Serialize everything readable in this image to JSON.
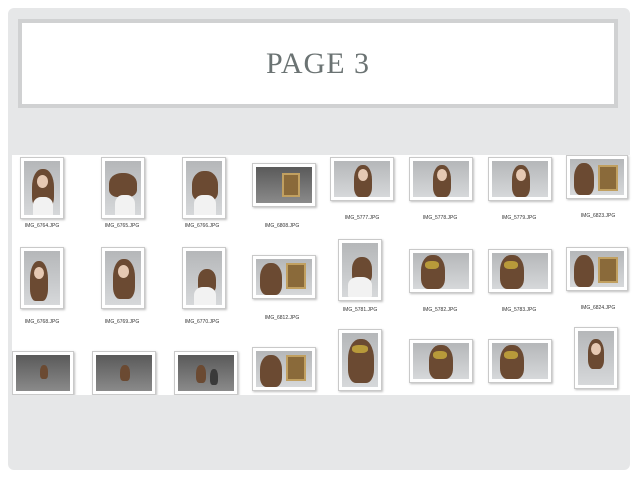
{
  "slide": {
    "title": "PAGE 3"
  },
  "contact_sheet": {
    "thumbnails": [
      {
        "id": "t1",
        "caption": "IMG_6764.JPG"
      },
      {
        "id": "t2",
        "caption": "IMG_6765.JPG"
      },
      {
        "id": "t3",
        "caption": "IMG_6766.JPG"
      },
      {
        "id": "t4",
        "caption": "IMG_6808.JPG"
      },
      {
        "id": "t5",
        "caption": "IMG_5777.JPG"
      },
      {
        "id": "t6",
        "caption": "IMG_5778.JPG"
      },
      {
        "id": "t7",
        "caption": "IMG_5779.JPG"
      },
      {
        "id": "t8",
        "caption": "IMG_6823.JPG"
      },
      {
        "id": "t9",
        "caption": "IMG_6768.JPG"
      },
      {
        "id": "t10",
        "caption": "IMG_6769.JPG"
      },
      {
        "id": "t11",
        "caption": "IMG_6770.JPG"
      },
      {
        "id": "t12",
        "caption": "IMG_6812.JPG"
      },
      {
        "id": "t13",
        "caption": "IMG_5781.JPG"
      },
      {
        "id": "t14",
        "caption": "IMG_5782.JPG"
      },
      {
        "id": "t15",
        "caption": "IMG_5783.JPG"
      },
      {
        "id": "t16",
        "caption": "IMG_6824.JPG"
      },
      {
        "id": "t17",
        "caption": ""
      },
      {
        "id": "t18",
        "caption": ""
      },
      {
        "id": "t19",
        "caption": ""
      },
      {
        "id": "t20",
        "caption": ""
      },
      {
        "id": "t21",
        "caption": ""
      },
      {
        "id": "t22",
        "caption": ""
      },
      {
        "id": "t23",
        "caption": ""
      },
      {
        "id": "t24",
        "caption": ""
      }
    ]
  }
}
